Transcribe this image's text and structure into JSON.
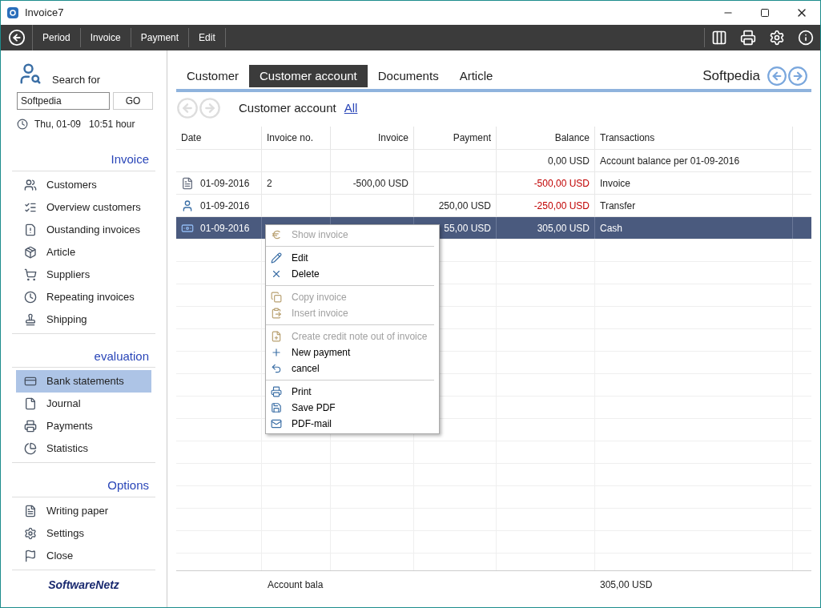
{
  "window": {
    "title": "Invoice7"
  },
  "toolbar": {
    "menus": [
      "Period",
      "Invoice",
      "Payment",
      "Edit"
    ]
  },
  "search": {
    "label": "Search for",
    "value": "Softpedia",
    "button": "GO",
    "datetime": "Thu, 01-09   10:51 hour"
  },
  "sidebar": [
    {
      "title": "Invoice",
      "items": [
        {
          "label": "Customers",
          "selected": false
        },
        {
          "label": "Overview customers",
          "selected": false
        },
        {
          "label": "Oustanding invoices",
          "selected": false
        },
        {
          "label": "Article",
          "selected": false
        },
        {
          "label": "Suppliers",
          "selected": false
        },
        {
          "label": "Repeating invoices",
          "selected": false
        },
        {
          "label": "Shipping",
          "selected": false
        }
      ]
    },
    {
      "title": "evaluation",
      "items": [
        {
          "label": "Bank statements",
          "selected": true
        },
        {
          "label": "Journal",
          "selected": false
        },
        {
          "label": "Payments",
          "selected": false
        },
        {
          "label": "Statistics",
          "selected": false
        }
      ]
    },
    {
      "title": "Options",
      "items": [
        {
          "label": "Writing paper",
          "selected": false
        },
        {
          "label": "Settings",
          "selected": false
        },
        {
          "label": "Close",
          "selected": false
        }
      ]
    }
  ],
  "brand": "SoftwareNetz",
  "tabs": [
    {
      "label": "Customer",
      "selected": false
    },
    {
      "label": "Customer account",
      "selected": true
    },
    {
      "label": "Documents",
      "selected": false
    },
    {
      "label": "Article",
      "selected": false
    }
  ],
  "customer_name": "Softpedia",
  "subheader": {
    "title": "Customer account",
    "link": "All"
  },
  "table": {
    "columns": [
      "Date",
      "Invoice no.",
      "Invoice",
      "Payment",
      "Balance",
      "Transactions"
    ],
    "rows": [
      {
        "kind": "opening",
        "selected": false,
        "date": "",
        "invoice_no": "",
        "invoice": "",
        "payment": "",
        "balance": "0,00 USD",
        "negative": false,
        "transaction": "Account balance per 01-09-2016"
      },
      {
        "kind": "invoice",
        "selected": false,
        "date": "01-09-2016",
        "invoice_no": "2",
        "invoice": "-500,00 USD",
        "payment": "",
        "balance": "-500,00 USD",
        "negative": true,
        "transaction": "Invoice"
      },
      {
        "kind": "transfer",
        "selected": false,
        "date": "01-09-2016",
        "invoice_no": "",
        "invoice": "",
        "payment": "250,00 USD",
        "balance": "-250,00 USD",
        "negative": true,
        "transaction": "Transfer"
      },
      {
        "kind": "cash",
        "selected": true,
        "date": "01-09-2016",
        "invoice_no": "",
        "invoice": "",
        "payment": "55,00 USD",
        "balance": "305,00 USD",
        "negative": false,
        "transaction": "Cash"
      }
    ],
    "footer": {
      "label": "Account bala",
      "total": "305,00 USD"
    }
  },
  "context_menu": [
    [
      {
        "label": "Show invoice",
        "disabled": true
      }
    ],
    [
      {
        "label": "Edit",
        "disabled": false
      },
      {
        "label": "Delete",
        "disabled": false
      }
    ],
    [
      {
        "label": "Copy invoice",
        "disabled": true
      },
      {
        "label": "Insert invoice",
        "disabled": true
      }
    ],
    [
      {
        "label": "Create credit note out of invoice",
        "disabled": true
      },
      {
        "label": "New payment",
        "disabled": false
      },
      {
        "label": "cancel",
        "disabled": false
      }
    ],
    [
      {
        "label": "Print",
        "disabled": false
      },
      {
        "label": "Save PDF",
        "disabled": false
      },
      {
        "label": "PDF-mail",
        "disabled": false
      }
    ]
  ]
}
